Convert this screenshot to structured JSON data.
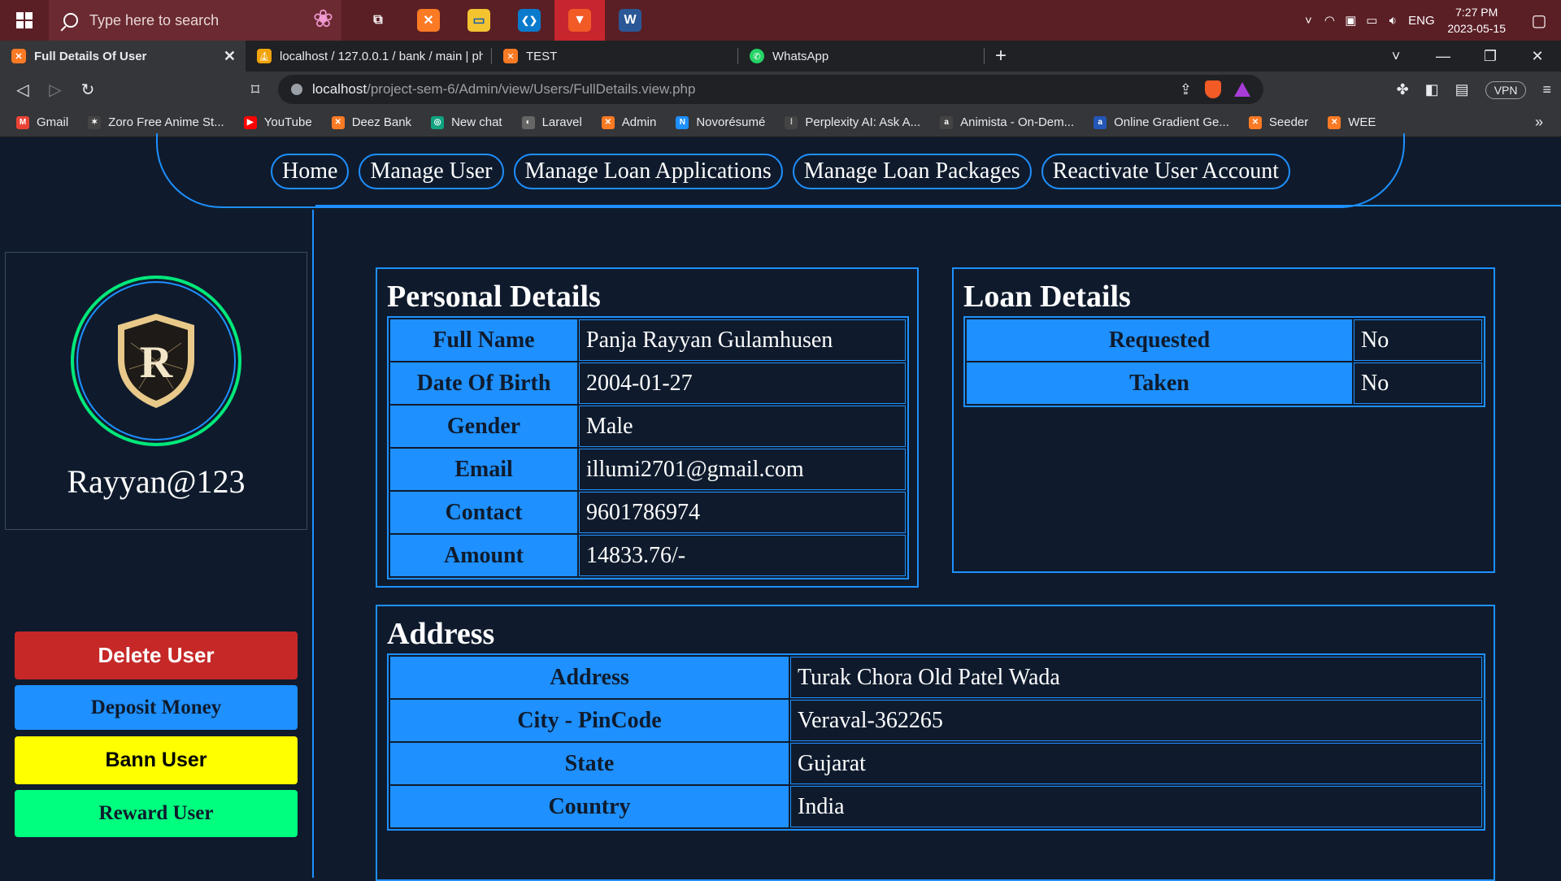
{
  "taskbar": {
    "search_placeholder": "Type here to search",
    "apps": [
      {
        "name": "task-view",
        "glyph": "⧉"
      },
      {
        "name": "xampp",
        "glyph": "✕"
      },
      {
        "name": "file-explorer",
        "glyph": "▭"
      },
      {
        "name": "vscode",
        "glyph": "❮❯"
      },
      {
        "name": "brave",
        "glyph": "▼"
      },
      {
        "name": "word",
        "glyph": "W"
      }
    ],
    "language": "ENG",
    "time": "7:27 PM",
    "date": "2023-05-15"
  },
  "browser": {
    "tabs": [
      {
        "label": "Full Details Of User",
        "active": true
      },
      {
        "label": "localhost / 127.0.0.1 / bank / main | ph",
        "active": false
      },
      {
        "label": "TEST",
        "active": false
      },
      {
        "label": "WhatsApp",
        "active": false
      }
    ],
    "url_host": "localhost",
    "url_path": "/project-sem-6/Admin/view/Users/FullDetails.view.php",
    "vpn_label": "VPN",
    "bookmarks": [
      {
        "label": "Gmail",
        "color": "#ea4335",
        "glyph": "M"
      },
      {
        "label": "Zoro Free Anime St...",
        "color": "#444",
        "glyph": "✶"
      },
      {
        "label": "YouTube",
        "color": "#ff0000",
        "glyph": "▶"
      },
      {
        "label": "Deez Bank",
        "color": "#fb7a24",
        "glyph": "✕"
      },
      {
        "label": "New chat",
        "color": "#10a37f",
        "glyph": "◎"
      },
      {
        "label": "Laravel",
        "color": "#666",
        "glyph": "◐"
      },
      {
        "label": "Admin",
        "color": "#fb7a24",
        "glyph": "✕"
      },
      {
        "label": "Novorésumé",
        "color": "#1e90ff",
        "glyph": "N"
      },
      {
        "label": "Perplexity AI: Ask A...",
        "color": "#444",
        "glyph": "⁞"
      },
      {
        "label": "Animista - On-Dem...",
        "color": "#444",
        "glyph": "a"
      },
      {
        "label": "Online Gradient Ge...",
        "color": "#2456b7",
        "glyph": "a"
      },
      {
        "label": "Seeder",
        "color": "#fb7a24",
        "glyph": "✕"
      },
      {
        "label": "WEE",
        "color": "#fb7a24",
        "glyph": "✕"
      }
    ]
  },
  "nav": {
    "links": [
      "Home",
      "Manage User",
      "Manage Loan Applications",
      "Manage Loan Packages",
      "Reactivate User Account"
    ]
  },
  "profile": {
    "emblem_letter": "R",
    "username": "Rayyan@123"
  },
  "actions": [
    {
      "label": "Delete User",
      "bg": "#c62828",
      "color": "#ffffff",
      "font": "Liberation Sans"
    },
    {
      "label": "Deposit Money",
      "bg": "#1e90ff",
      "color": "#0f1b2d",
      "font": "Liberation Serif"
    },
    {
      "label": "Bann User",
      "bg": "#ffff00",
      "color": "#000000",
      "font": "Liberation Sans"
    },
    {
      "label": "Reward User",
      "bg": "#00ff7f",
      "color": "#0f1b2d",
      "font": "Liberation Serif"
    }
  ],
  "personal": {
    "title": "Personal Details",
    "rows": [
      {
        "key": "Full Name",
        "value": "Panja Rayyan Gulamhusen"
      },
      {
        "key": "Date Of Birth",
        "value": "2004-01-27"
      },
      {
        "key": "Gender",
        "value": "Male"
      },
      {
        "key": "Email",
        "value": "illumi2701@gmail.com"
      },
      {
        "key": "Contact",
        "value": "9601786974"
      },
      {
        "key": "Amount",
        "value": "14833.76/-"
      }
    ]
  },
  "loan": {
    "title": "Loan Details",
    "rows": [
      {
        "key": "Requested",
        "value": "No"
      },
      {
        "key": "Taken",
        "value": "No"
      }
    ]
  },
  "address": {
    "title": "Address",
    "rows": [
      {
        "key": "Address",
        "value": "Turak Chora Old Patel Wada"
      },
      {
        "key": "City - PinCode",
        "value": "Veraval-362265"
      },
      {
        "key": "State",
        "value": "Gujarat"
      },
      {
        "key": "Country",
        "value": "India"
      }
    ]
  },
  "colors": {
    "accent": "#1e90ff",
    "background": "#0f1b2d",
    "avatar_ring": "#00e87a"
  }
}
